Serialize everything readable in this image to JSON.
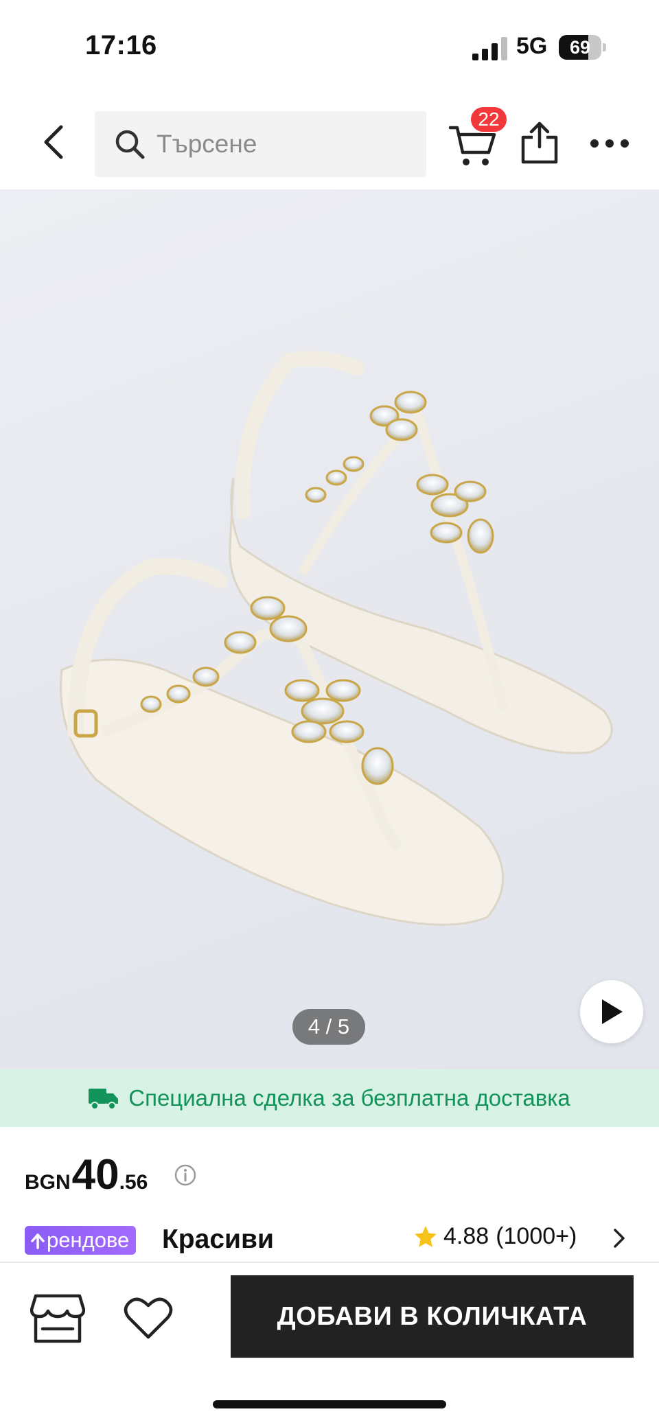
{
  "status_bar": {
    "time": "17:16",
    "network": "5G",
    "battery_level": "69",
    "battery_fraction": 0.69
  },
  "header": {
    "search_placeholder": "Търсене",
    "cart_count": "22",
    "icons": [
      "back-icon",
      "search-icon",
      "cart-icon",
      "share-icon",
      "more-icon"
    ]
  },
  "gallery": {
    "page_indicator": "4 / 5",
    "current_page": 4,
    "total_pages": 5,
    "icons": [
      "play-icon"
    ]
  },
  "promo": {
    "text": "Специална сделка за безплатна доставка",
    "color": "#12935a",
    "background": "#d9f2e6",
    "icon": "truck-icon"
  },
  "price": {
    "currency": "BGN",
    "integer": "40",
    "decimal": ".56",
    "icon": "info-icon"
  },
  "product": {
    "trend_badge": "рендове",
    "title": "Красиви",
    "rating": "4.88",
    "review_count": "(1000+)",
    "trend_color": "#8a5cf6",
    "star_color": "#f7c21a"
  },
  "bottom_bar": {
    "add_to_cart_label": "ДОБАВИ В КОЛИЧКАТА",
    "button_color": "#222222",
    "icons": [
      "store-icon",
      "heart-icon"
    ]
  }
}
